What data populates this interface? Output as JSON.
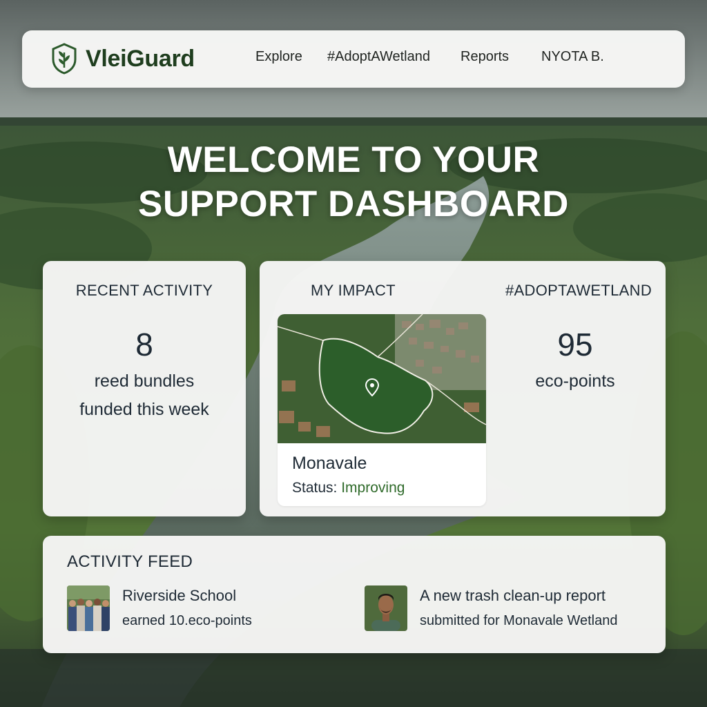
{
  "brand": {
    "name": "VleiGuard",
    "logo_icon": "leaf-shield-icon",
    "color": "#1e3d1e"
  },
  "nav": {
    "links": [
      "Explore",
      "#AdoptAWetland",
      "Reports"
    ],
    "user": "NYOTA B."
  },
  "hero": {
    "line1": "WELCOME TO YOUR",
    "line2": "SUPPORT DASHBOARD"
  },
  "recent_activity": {
    "title": "RECENT ACTIVITY",
    "count": "8",
    "line1": "reed bundles",
    "line2": "funded this week"
  },
  "impact": {
    "title": "MY IMPACT",
    "wetland_name": "Monavale",
    "status_label": "Status:",
    "status_value": "Improving",
    "status_color": "#2f6a2a",
    "map_icon": "map-pin-icon"
  },
  "adopt": {
    "title": "#ADOPTAWETLAND",
    "points": "95",
    "points_label": "eco-points"
  },
  "feed": {
    "title": "ACTIVITY FEED",
    "items": [
      {
        "line1": "Riverside School",
        "line2": "earned 10.eco-points",
        "avatar": "group-photo"
      },
      {
        "line1": "A new trash clean-up report",
        "line2": "submitted for Monavale Wetland",
        "avatar": "person-photo"
      }
    ]
  }
}
